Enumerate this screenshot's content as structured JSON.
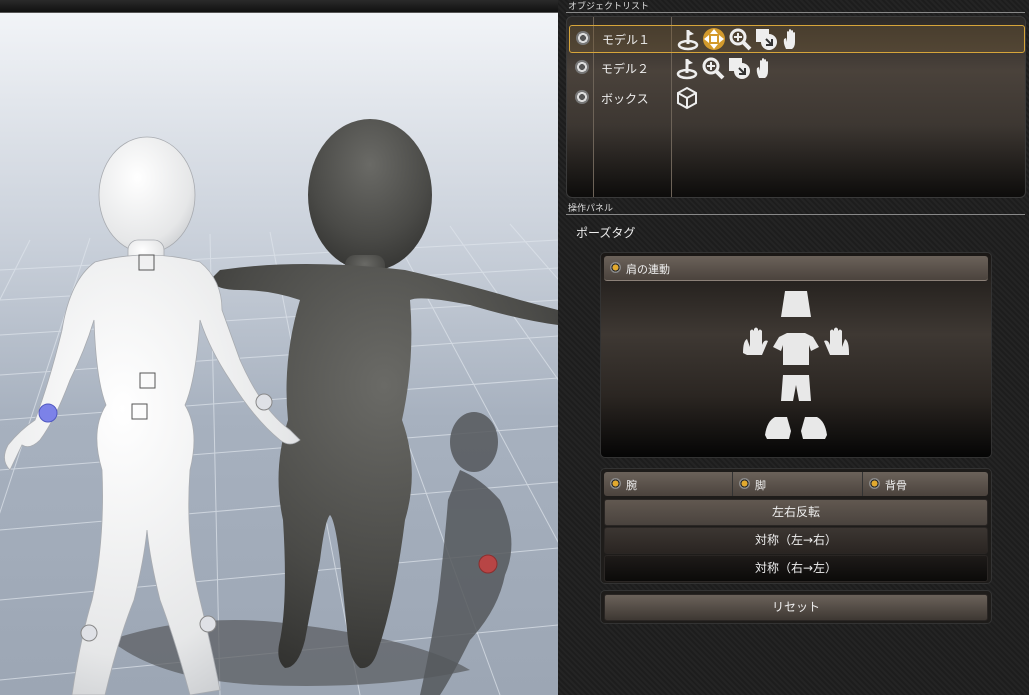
{
  "object_list": {
    "label": "オブジェクトリスト",
    "items": [
      {
        "name": "モデル１",
        "selected": true,
        "tools": [
          "rotate-icon",
          "move-icon",
          "zoom-icon",
          "reset-icon",
          "hand-icon"
        ]
      },
      {
        "name": "モデル２",
        "selected": false,
        "tools": [
          "rotate-icon",
          "zoom-icon",
          "reset-icon",
          "hand-icon"
        ]
      },
      {
        "name": "ボックス",
        "selected": false,
        "tools": [
          "box-icon"
        ]
      }
    ]
  },
  "operation_panel": {
    "label": "操作パネル",
    "pose_tag_label": "ポーズタグ",
    "shoulder_link_label": "肩の連動",
    "parts": [
      "腕",
      "脚",
      "背骨"
    ],
    "flip_label": "左右反転",
    "mirror_lr_label": "対称（左→右）",
    "mirror_rl_label": "対称（右→左）",
    "reset_label": "リセット"
  },
  "colors": {
    "accent": "#e2a92e",
    "selection_border": "#d6a53a",
    "panel_bg": "#222222"
  }
}
